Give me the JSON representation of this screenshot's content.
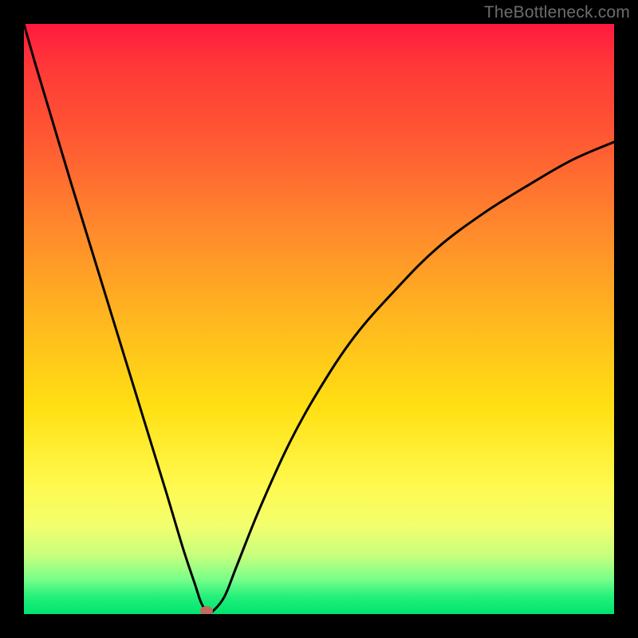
{
  "watermark": "TheBottleneck.com",
  "chart_data": {
    "type": "line",
    "title": "",
    "xlabel": "",
    "ylabel": "",
    "xlim": [
      0,
      100
    ],
    "ylim": [
      0,
      100
    ],
    "grid": false,
    "legend": false,
    "series": [
      {
        "name": "bottleneck-curve",
        "x": [
          0,
          2,
          5,
          8,
          12,
          16,
          20,
          24,
          27,
          29,
          30,
          31,
          32,
          34,
          36,
          40,
          45,
          50,
          56,
          63,
          70,
          78,
          86,
          93,
          100
        ],
        "y": [
          100,
          93,
          83,
          73,
          60,
          47,
          34,
          21,
          11,
          5,
          2,
          0.5,
          0.5,
          3,
          8,
          18,
          29,
          38,
          47,
          55,
          62,
          68,
          73,
          77,
          80
        ]
      }
    ],
    "marker": {
      "x": 31,
      "y": 0.5,
      "color": "#c46a63"
    },
    "background": "red-yellow-green vertical gradient",
    "colors": {
      "top": "#ff1a3f",
      "mid": "#ffe013",
      "bottom": "#00e46e",
      "curve": "#000000",
      "frame": "#000000"
    }
  }
}
